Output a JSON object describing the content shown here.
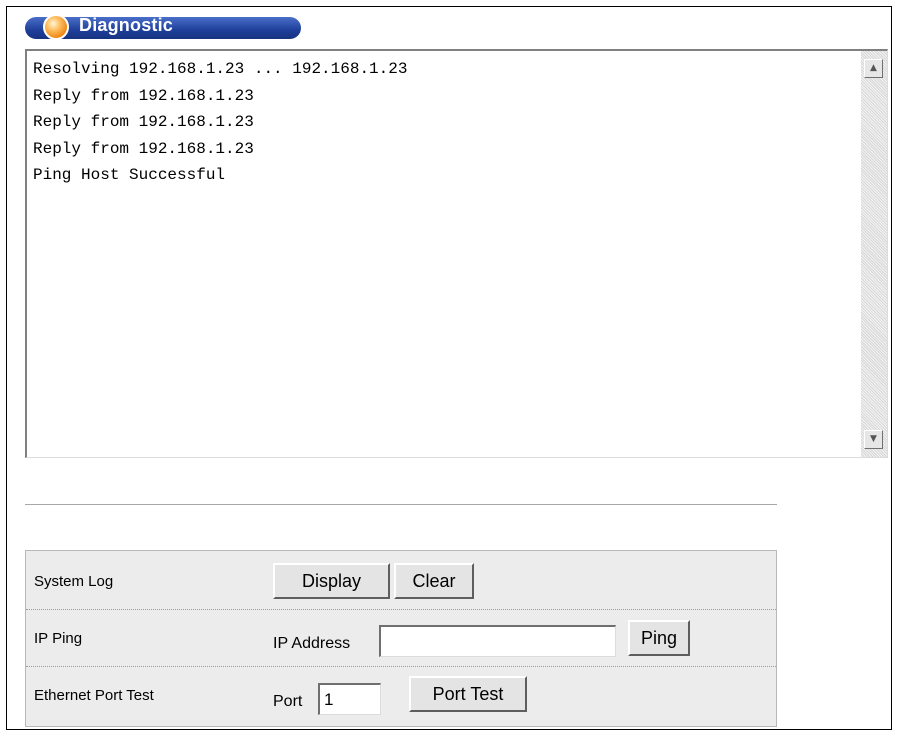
{
  "header": {
    "title": "Diagnostic"
  },
  "output": {
    "lines": [
      "Resolving 192.168.1.23 ... 192.168.1.23",
      "Reply from 192.168.1.23",
      "Reply from 192.168.1.23",
      "Reply from 192.168.1.23",
      "Ping Host Successful"
    ]
  },
  "scrollbar": {
    "up_icon": "triangle-up",
    "down_icon": "triangle-down",
    "up_glyph": "▲",
    "down_glyph": "▼"
  },
  "panel": {
    "system_log": {
      "label": "System Log",
      "display_button": "Display",
      "clear_button": "Clear"
    },
    "ip_ping": {
      "label": "IP Ping",
      "address_label": "IP Address",
      "address_value": "",
      "ping_button": "Ping"
    },
    "port_test": {
      "label": "Ethernet Port Test",
      "port_label": "Port",
      "port_value": "1",
      "port_test_button": "Port Test"
    }
  },
  "colors": {
    "title_bar": "#1e3f9a",
    "title_orb": "#f08a18",
    "panel_bg": "#ececec"
  }
}
